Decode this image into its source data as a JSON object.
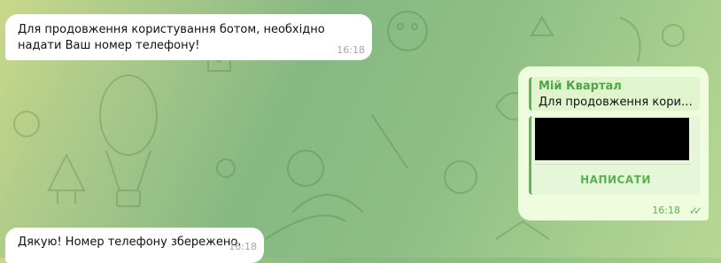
{
  "messages": [
    {
      "text": "Для продовження користування ботом, необхідно надати Ваш номер телефону!",
      "time": "16:18"
    },
    {
      "text": "Дякую! Номер телефону збережено.",
      "time": "16:18"
    }
  ],
  "outgoing": {
    "reply_name": "Мій Квартал",
    "reply_text": "Для продовження користу...",
    "button_label": "НАПИСАТИ",
    "time": "16:18",
    "status_icon": "double-check-icon"
  },
  "colors": {
    "incoming_bubble": "#ffffff",
    "outgoing_bubble": "#effdde",
    "accent": "#5fb556"
  }
}
